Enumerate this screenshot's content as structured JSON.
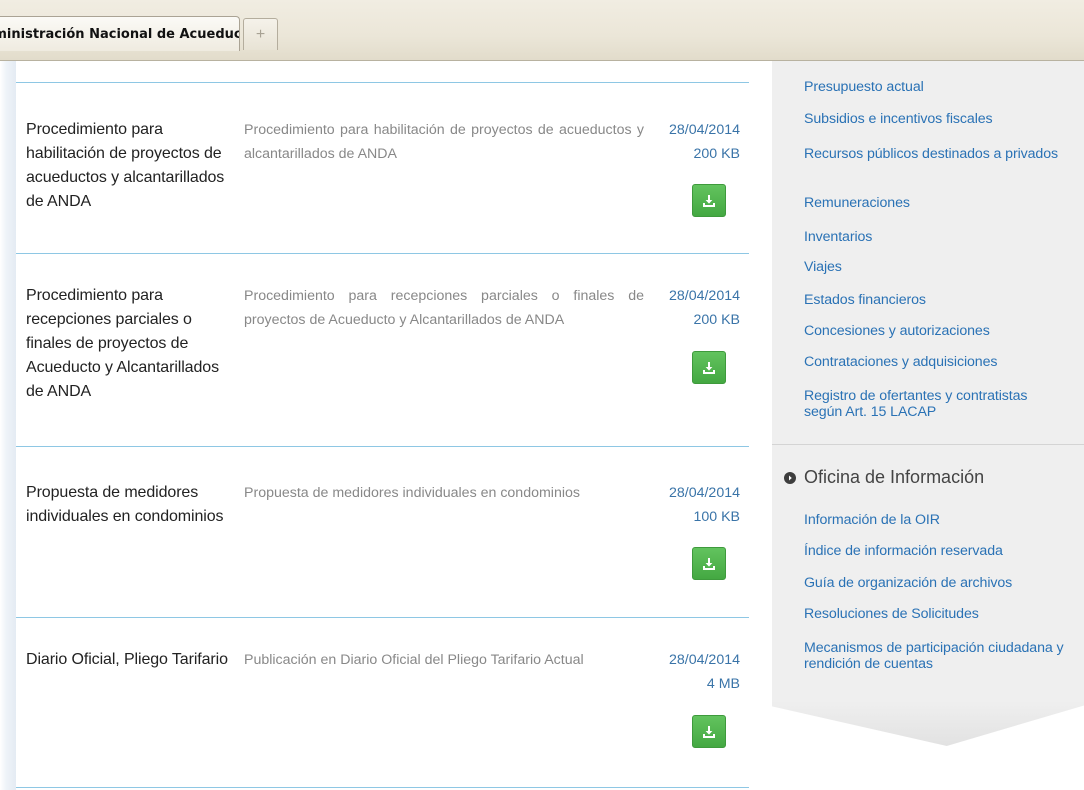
{
  "browser": {
    "tab_title": "Administración Nacional de Acueduc...",
    "new_tab_symbol": "+"
  },
  "documents": [
    {
      "name": "Procedimiento para habilitación de proyectos de acueductos y alcantarillados de ANDA",
      "description": "Procedimiento para habilitación de proyectos de acueductos y alcantarillados de ANDA",
      "date": "28/04/2014",
      "size": "200 KB"
    },
    {
      "name": "Procedimiento para recepciones parciales o finales de proyectos de Acueducto y Alcantarillados de ANDA",
      "description": "Procedimiento para recepciones parciales o finales de proyectos de Acueducto y Alcantarillados de ANDA",
      "date": "28/04/2014",
      "size": "200 KB"
    },
    {
      "name": "Propuesta de medidores individuales en condominios",
      "description": "Propuesta de medidores individuales en condominios",
      "date": "28/04/2014",
      "size": "100 KB"
    },
    {
      "name": "Diario Oficial, Pliego Tarifario",
      "description": "Publicación en Diario Oficial del Pliego Tarifario Actual",
      "date": "28/04/2014",
      "size": "4 MB"
    }
  ],
  "sidebar": {
    "links_top": [
      "Presupuesto actual",
      "Subsidios e incentivos fiscales",
      "Recursos públicos destinados a privados",
      "Remuneraciones",
      "Inventarios",
      "Viajes",
      "Estados financieros",
      "Concesiones y autorizaciones",
      "Contrataciones y adquisiciones",
      "Registro de ofertantes y contratistas según Art. 15 LACAP"
    ],
    "section_title": "Oficina de Información",
    "links_bottom": [
      "Información de la OIR",
      "Índice de información reservada",
      "Guía de organización de archivos",
      "Resoluciones de Solicitudes",
      "Mecanismos de participación ciudadana y rendición de cuentas"
    ]
  },
  "colors": {
    "link": "#2a72b5",
    "rule": "#8ec7e4",
    "download_button": "#4caf50"
  }
}
